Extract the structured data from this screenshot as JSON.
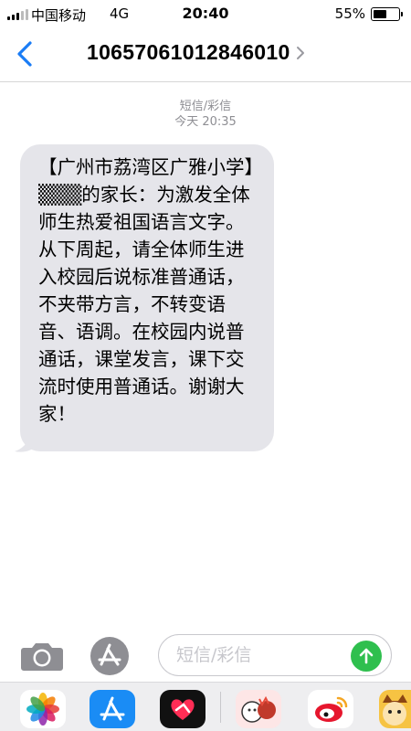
{
  "status_bar": {
    "carrier": "中国移动",
    "network": "4G",
    "time": "20:40",
    "battery_percent": "55%",
    "battery_level": 0.55
  },
  "nav": {
    "title": "1065706101284601 0"
  },
  "conversation": {
    "message_type": "短信/彩信",
    "timestamp": "今天 20:35",
    "messages": [
      {
        "sender": "incoming",
        "text": "【广州市荔湾区广雅小学】▒▒▒的家长：为激发全体师生热爱祖国语言文字。从下周起，请全体师生进入校园后说标准普通话，不夹带方言，不转变语音、语调。在校园内说普通话，课堂发言，课下交流时使用普通话。谢谢大家！"
      }
    ]
  },
  "input_bar": {
    "placeholder": "短信/彩信"
  },
  "app_drawer": {
    "apps": [
      {
        "name": "photos-icon"
      },
      {
        "name": "app-store-icon"
      },
      {
        "name": "digital-touch-icon"
      },
      {
        "name": "cartoon-sticker-icon"
      },
      {
        "name": "weibo-icon"
      },
      {
        "name": "cartoon-cat-icon"
      }
    ]
  },
  "colors": {
    "accent_blue": "#1a7cf5",
    "bubble_gray": "#e5e5ea",
    "send_green": "#2fbf4e",
    "timestamp_gray": "#8e8e93"
  }
}
